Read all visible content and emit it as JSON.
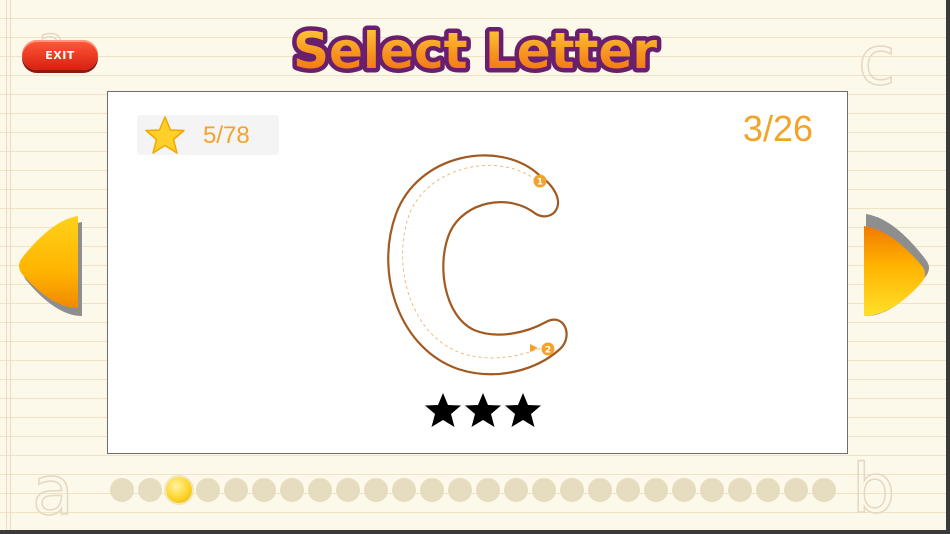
{
  "header": {
    "title": "Select Letter",
    "exit_label": "EXIT"
  },
  "score": {
    "value": "5/78",
    "icon": "star-icon"
  },
  "progress": {
    "value": "3/26"
  },
  "letter": {
    "current": "C",
    "stroke_marks": [
      "1",
      "2"
    ]
  },
  "rating": {
    "stars_earned": 3,
    "stars_total": 3
  },
  "navigation": {
    "prev_icon": "arrow-left-icon",
    "next_icon": "arrow-right-icon"
  },
  "letter_dots": {
    "count": 26,
    "active_index": 2
  },
  "decorations": [
    "a",
    "b",
    "c"
  ],
  "colors": {
    "accent_orange": "#f2a32c",
    "title_orange": "#f7931e",
    "title_outline": "#6a1f6e",
    "exit_red": "#e2301a",
    "arrow_yellow": "#ffc40a"
  }
}
